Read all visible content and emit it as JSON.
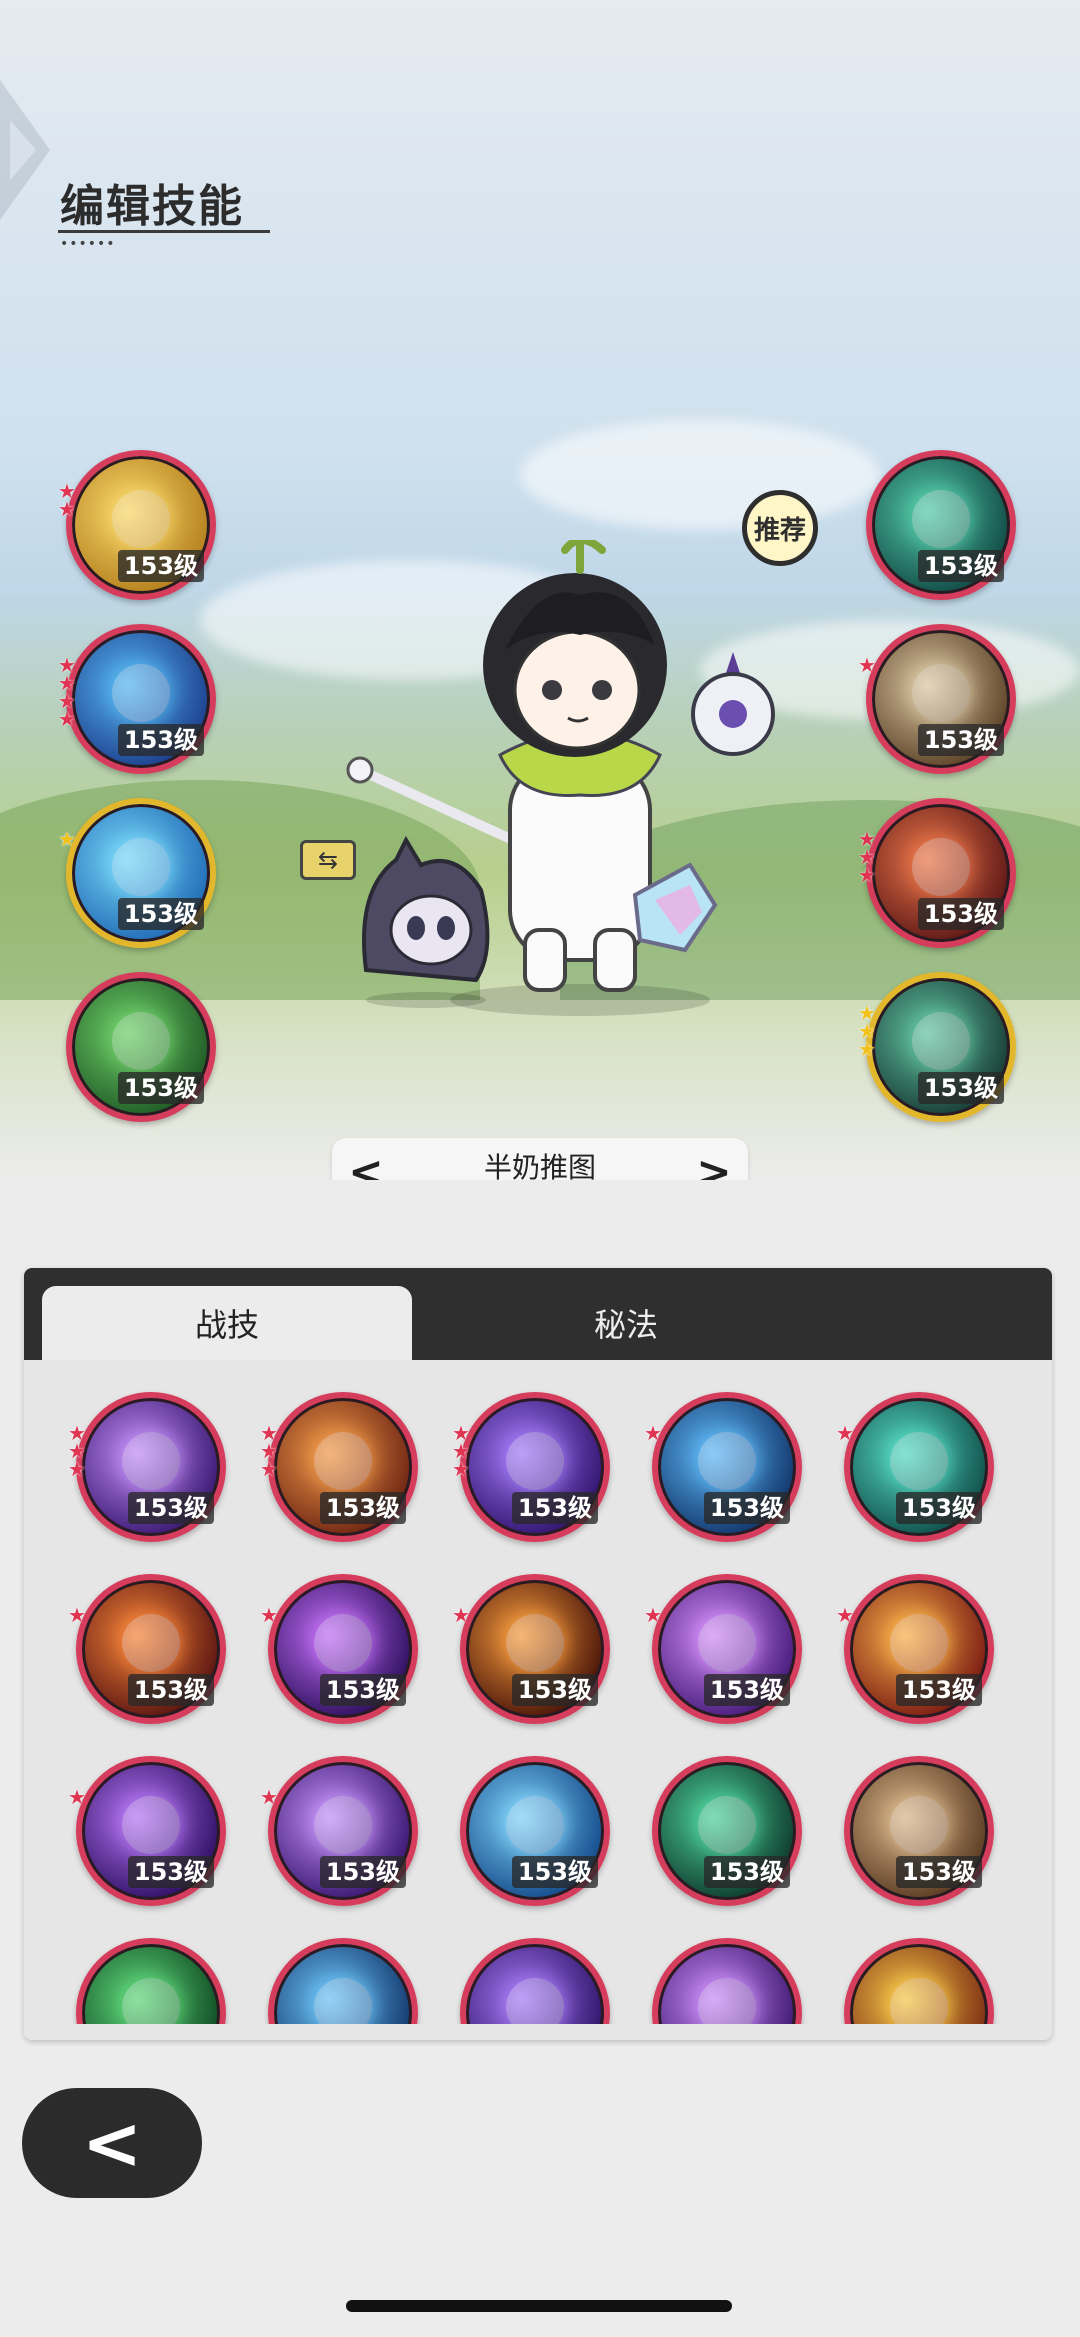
{
  "header": {
    "title": "编辑技能"
  },
  "recommend_label": "推荐",
  "preset": {
    "name": "半奶推图",
    "prev": "<",
    "next": ">",
    "progress": 0.8
  },
  "tabs": [
    {
      "label": "战技",
      "active": true
    },
    {
      "label": "秘法",
      "active": false
    }
  ],
  "equipped_left": [
    {
      "icon": "golden-sparkle-icon",
      "level": "153级",
      "stars": 2,
      "star_color": "red",
      "colors": [
        "#f7d66a",
        "#b4801c"
      ]
    },
    {
      "icon": "ice-golem-icon",
      "level": "153级",
      "stars": 4,
      "star_color": "red",
      "colors": [
        "#56b6ef",
        "#1c3e8c"
      ]
    },
    {
      "icon": "frost-beast-icon",
      "level": "153级",
      "stars": 1,
      "star_color": "yellow",
      "colors": [
        "#79d7f7",
        "#1f6bb6"
      ],
      "gold": true
    },
    {
      "icon": "nature-shield-icon",
      "level": "153级",
      "stars": 0,
      "colors": [
        "#6fcf6a",
        "#1f5a25"
      ]
    }
  ],
  "equipped_right": [
    {
      "icon": "shadow-figure-icon",
      "level": "153级",
      "stars": 0,
      "colors": [
        "#55caa9",
        "#104a45"
      ]
    },
    {
      "icon": "light-pillar-icon",
      "level": "153级",
      "stars": 1,
      "star_color": "red",
      "colors": [
        "#d9c6a1",
        "#5c4227"
      ]
    },
    {
      "icon": "fire-claw-icon",
      "level": "153级",
      "stars": 3,
      "star_color": "red",
      "colors": [
        "#e9764a",
        "#5d1716"
      ]
    },
    {
      "icon": "jade-golem-icon",
      "level": "153级",
      "stars": 3,
      "star_color": "yellow",
      "colors": [
        "#62c3a0",
        "#173b35"
      ],
      "gold": true
    }
  ],
  "skills": [
    {
      "icon": "violet-hand-icon",
      "level": "153级",
      "stars": 3,
      "colors": [
        "#c18cf5",
        "#3a1872"
      ]
    },
    {
      "icon": "stone-totem-icon",
      "level": "153级",
      "stars": 3,
      "colors": [
        "#f09a4a",
        "#6e2412"
      ]
    },
    {
      "icon": "purple-warrior-icon",
      "level": "153级",
      "stars": 3,
      "colors": [
        "#a27af5",
        "#30136e"
      ]
    },
    {
      "icon": "blue-wave-icon",
      "level": "153级",
      "stars": 1,
      "colors": [
        "#5fb8f5",
        "#10356b"
      ]
    },
    {
      "icon": "teal-vortex-icon",
      "level": "153级",
      "stars": 1,
      "colors": [
        "#56d8c2",
        "#0f4f4a"
      ]
    },
    {
      "icon": "flame-icon",
      "level": "153级",
      "stars": 1,
      "colors": [
        "#f5843a",
        "#5a1410"
      ]
    },
    {
      "icon": "purple-eye-icon",
      "level": "153级",
      "stars": 1,
      "colors": [
        "#c06ef3",
        "#2d0f5e"
      ]
    },
    {
      "icon": "fire-swirl-icon",
      "level": "153级",
      "stars": 1,
      "colors": [
        "#f39a3e",
        "#4a1408"
      ]
    },
    {
      "icon": "violet-burst-icon",
      "level": "153级",
      "stars": 1,
      "colors": [
        "#d08cf5",
        "#461a7a"
      ]
    },
    {
      "icon": "fire-orb-icon",
      "level": "153级",
      "stars": 1,
      "colors": [
        "#f7b04a",
        "#7a1a12"
      ]
    },
    {
      "icon": "purple-comet-icon",
      "level": "153级",
      "stars": 1,
      "colors": [
        "#b576f3",
        "#2e0f63"
      ]
    },
    {
      "icon": "purple-star-icon",
      "level": "153级",
      "stars": 1,
      "colors": [
        "#c290f6",
        "#3a1570"
      ]
    },
    {
      "icon": "ice-shatter-icon",
      "level": "153级",
      "stars": 0,
      "colors": [
        "#7fd0f7",
        "#134a8a"
      ]
    },
    {
      "icon": "green-thorn-icon",
      "level": "153级",
      "stars": 0,
      "colors": [
        "#4ed09a",
        "#0d3a2d"
      ]
    },
    {
      "icon": "earth-shield-icon",
      "level": "153级",
      "stars": 0,
      "colors": [
        "#d8b58a",
        "#5a3b22"
      ]
    },
    {
      "icon": "green-heal-icon",
      "level": "",
      "stars": 0,
      "colors": [
        "#5fd67a",
        "#0e4a22"
      ]
    },
    {
      "icon": "blue-blade-icon",
      "level": "",
      "stars": 0,
      "colors": [
        "#6cc2f5",
        "#10356b"
      ]
    },
    {
      "icon": "purple-crest-icon",
      "level": "",
      "stars": 0,
      "colors": [
        "#a77af5",
        "#2b1266"
      ]
    },
    {
      "icon": "violet-link-icon",
      "level": "",
      "stars": 0,
      "colors": [
        "#c88cf5",
        "#3e1770"
      ]
    },
    {
      "icon": "fire-cage-icon",
      "level": "",
      "stars": 0,
      "colors": [
        "#f5c64a",
        "#7a2a10"
      ]
    }
  ],
  "back_label": "<"
}
